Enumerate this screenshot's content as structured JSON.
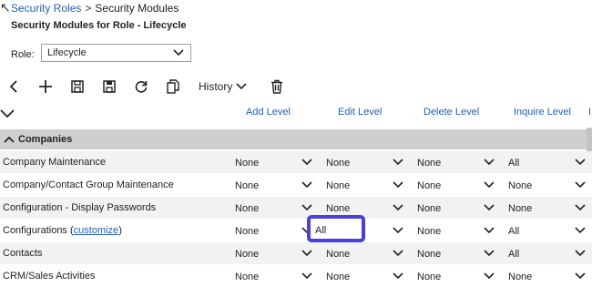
{
  "breadcrumb": {
    "root": "Security Roles",
    "separator": ">",
    "current": "Security Modules"
  },
  "page_title": "Security Modules for Role - Lifecycle",
  "role": {
    "label": "Role:",
    "value": "Lifecycle"
  },
  "toolbar": {
    "history_label": "History"
  },
  "columns": [
    "Add Level",
    "Edit Level",
    "Delete Level",
    "Inquire Level",
    "I"
  ],
  "section": {
    "label": "Companies"
  },
  "rows": [
    {
      "name": "Company Maintenance",
      "add": "None",
      "edit": "None",
      "delete": "None",
      "inquire": "All"
    },
    {
      "name": "Company/Contact Group Maintenance",
      "add": "None",
      "edit": "None",
      "delete": "None",
      "inquire": "None"
    },
    {
      "name": "Configuration - Display Passwords",
      "add": "None",
      "edit": "None",
      "delete": "None",
      "inquire": "None"
    },
    {
      "name": "Configurations (",
      "link": "customize",
      "suffix": ")",
      "add": "None",
      "edit": "All",
      "delete": "None",
      "inquire": "All"
    },
    {
      "name": "Contacts",
      "add": "None",
      "edit": "None",
      "delete": "None",
      "inquire": "All"
    },
    {
      "name": "CRM/Sales Activities",
      "add": "None",
      "edit": "None",
      "delete": "None",
      "inquire": "None"
    }
  ],
  "colors": {
    "link": "#1f5fbf",
    "section_bg": "#cfcfcf",
    "highlight": "#4a3fe0"
  }
}
